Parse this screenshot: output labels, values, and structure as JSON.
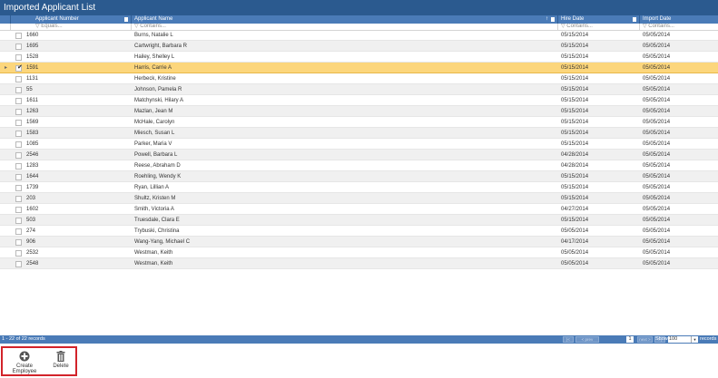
{
  "window": {
    "title": "Imported Applicant List"
  },
  "columns": {
    "applicant_number": "Applicant Number",
    "applicant_name": "Applicant Name",
    "hire_date": "Hire Date",
    "import_date": "Import Date"
  },
  "filters": {
    "applicant_number": "▽ Equals...",
    "applicant_name": "▽ Contains...",
    "hire_date": "▽ Contains...",
    "import_date": "▽ Contains..."
  },
  "sort": {
    "applicant_name": "ascending"
  },
  "rows": [
    {
      "number": "1660",
      "name": "Burns, Natalie L",
      "hire": "05/15/2014",
      "import": "05/05/2014",
      "checked": false
    },
    {
      "number": "1695",
      "name": "Cartwright, Barbara R",
      "hire": "05/15/2014",
      "import": "05/05/2014",
      "checked": false
    },
    {
      "number": "1528",
      "name": "Hailey, Shelley L",
      "hire": "05/15/2014",
      "import": "05/05/2014",
      "checked": false
    },
    {
      "number": "1591",
      "name": "Harris, Carrie A",
      "hire": "05/15/2014",
      "import": "05/05/2014",
      "checked": true
    },
    {
      "number": "1131",
      "name": "Herbeck, Kristine",
      "hire": "05/15/2014",
      "import": "05/05/2014",
      "checked": false
    },
    {
      "number": "55",
      "name": "Johnson, Pamela R",
      "hire": "05/15/2014",
      "import": "05/05/2014",
      "checked": false
    },
    {
      "number": "1611",
      "name": "Matchynski, Hilary A",
      "hire": "05/15/2014",
      "import": "05/05/2014",
      "checked": false
    },
    {
      "number": "1263",
      "name": "Mazlan, Jean M",
      "hire": "05/15/2014",
      "import": "05/05/2014",
      "checked": false
    },
    {
      "number": "1569",
      "name": "McHale, Carolyn",
      "hire": "05/15/2014",
      "import": "05/05/2014",
      "checked": false
    },
    {
      "number": "1583",
      "name": "Miesch, Susan L",
      "hire": "05/15/2014",
      "import": "05/05/2014",
      "checked": false
    },
    {
      "number": "1085",
      "name": "Parker, Maria V",
      "hire": "05/15/2014",
      "import": "05/05/2014",
      "checked": false
    },
    {
      "number": "2546",
      "name": "Powell, Barbara L",
      "hire": "04/28/2014",
      "import": "05/05/2014",
      "checked": false
    },
    {
      "number": "1283",
      "name": "Reese, Abraham D",
      "hire": "04/28/2014",
      "import": "05/05/2014",
      "checked": false
    },
    {
      "number": "1644",
      "name": "Roehling, Wendy K",
      "hire": "05/15/2014",
      "import": "05/05/2014",
      "checked": false
    },
    {
      "number": "1739",
      "name": "Ryan, Lillian A",
      "hire": "05/15/2014",
      "import": "05/05/2014",
      "checked": false
    },
    {
      "number": "203",
      "name": "Shultz, Kristen M",
      "hire": "05/15/2014",
      "import": "05/05/2014",
      "checked": false
    },
    {
      "number": "1602",
      "name": "Smith, Victoria A",
      "hire": "04/27/2014",
      "import": "05/05/2014",
      "checked": false
    },
    {
      "number": "503",
      "name": "Truesdale, Clara E",
      "hire": "05/15/2014",
      "import": "05/05/2014",
      "checked": false
    },
    {
      "number": "274",
      "name": "Trybuski, Christina",
      "hire": "05/05/2014",
      "import": "05/05/2014",
      "checked": false
    },
    {
      "number": "906",
      "name": "Wang-Yang, Michael C",
      "hire": "04/17/2014",
      "import": "05/05/2014",
      "checked": false
    },
    {
      "number": "2532",
      "name": "Westman, Keith",
      "hire": "05/05/2014",
      "import": "05/05/2014",
      "checked": false
    },
    {
      "number": "2548",
      "name": "Westman, Keith",
      "hire": "05/05/2014",
      "import": "05/05/2014",
      "checked": false
    }
  ],
  "selected_row_index": 3,
  "pager": {
    "summary": "1 - 22 of 22 records",
    "first": "|<",
    "prev": "< prev",
    "current_page": "1",
    "next": "next >",
    "last": ">|",
    "show_label": "Show",
    "page_size": "100",
    "records_label": "records"
  },
  "toolbar": {
    "create_employee": "Create Employee",
    "delete": "Delete"
  },
  "colors": {
    "title_bar": "#2b5a8f",
    "header": "#4a7bb7",
    "selected_row": "#fcd67c",
    "alt_row": "#f0f0f0",
    "highlight_border": "#d2232a"
  },
  "icons": {
    "create_employee": "plus-circle-icon",
    "delete": "trash-icon",
    "row_indicator": "caret-right-icon",
    "check": "checkmark-icon"
  }
}
